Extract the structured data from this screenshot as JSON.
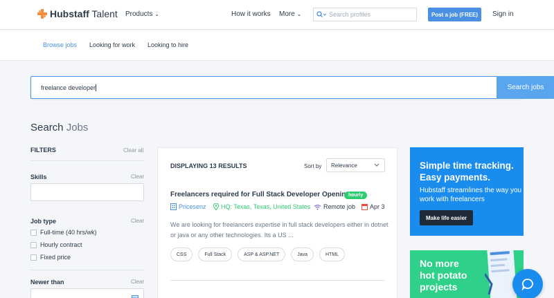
{
  "header": {
    "logo_bold": "Hubstaff",
    "logo_light": " Talent",
    "products": "Products",
    "how_it_works": "How it works",
    "more": "More",
    "search_placeholder": "Search profiles",
    "post_job": "Post a job (FREE)",
    "sign_in": "Sign in"
  },
  "subnav": {
    "tabs": [
      {
        "label": "Browse jobs",
        "active": true
      },
      {
        "label": "Looking for work"
      },
      {
        "label": "Looking to hire"
      }
    ]
  },
  "search": {
    "value": "freelance developer",
    "button": "Search jobs"
  },
  "page": {
    "title_bold": "Search",
    "title_light": " Jobs"
  },
  "filters": {
    "heading": "FILTERS",
    "clear_all": "Clear all",
    "skills_label": "Skills",
    "clear": "Clear",
    "job_type_label": "Job type",
    "job_types": [
      "Full-time (40 hrs/wk)",
      "Hourly contract",
      "Fixed price"
    ],
    "newer_than_label": "Newer than"
  },
  "results": {
    "count_text": "DISPLAYING 13 RESULTS",
    "sort_label": "Sort by",
    "sort_value": "Relevance",
    "job": {
      "title": "Freelancers required for Full Stack Developer Opening",
      "badge": "hourly",
      "company": "Pricesenz",
      "hq": "HQ: Texas, Texas, United States",
      "remote": "Remote job",
      "date": "Apr 3",
      "description": "We are looking for freelancers expertise in full stack developers either in dotnet or java or any other technologies. Its a US ...",
      "tags": [
        "CSS",
        "Full Stack",
        "ASP & ASP.NET",
        "Java",
        "HTML"
      ]
    }
  },
  "ads": {
    "ad1_title_1": "Simple time tracking.",
    "ad1_title_2": "Easy payments.",
    "ad1_sub": "Hubstaff streamlines the way you work with freelancers",
    "ad1_button": "Make life easier",
    "ad2_title_1": "No more",
    "ad2_title_2": "hot potato",
    "ad2_title_3": "projects"
  },
  "colors": {
    "accent": "#4a90e2",
    "green": "#2ecc71",
    "ad_blue": "#1a8ced",
    "ad_green": "#2fd08a"
  }
}
